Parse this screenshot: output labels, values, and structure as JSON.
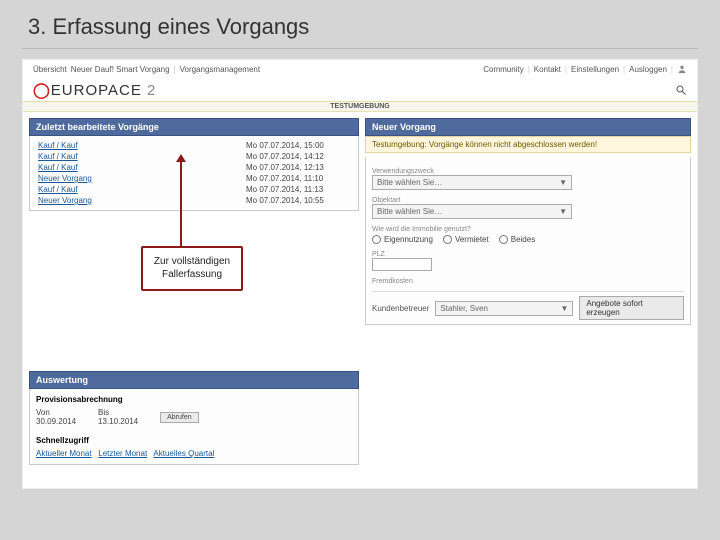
{
  "slide": {
    "title": "3. Erfassung eines Vorgangs"
  },
  "topnav": {
    "left": [
      "Übersicht",
      "Neuer Dauf! Smart Vorgang",
      "Vorgangsmanagement"
    ],
    "right": [
      "Community",
      "Kontakt",
      "Einstellungen",
      "Ausloggen"
    ]
  },
  "logo": {
    "brand": "EUROPACE",
    "suffix": "2"
  },
  "envband": "TESTUMGEBUNG",
  "leftpanel": {
    "header": "Zuletzt bearbeitete Vorgänge",
    "rows": [
      {
        "name": "Kauf / Kauf",
        "date": "Mo 07.07.2014, 15:00"
      },
      {
        "name": "Kauf / Kauf",
        "date": "Mo 07.07.2014, 14:12"
      },
      {
        "name": "Kauf / Kauf",
        "date": "Mo 07.07.2014, 12:13"
      },
      {
        "name": "Neuer Vorgang",
        "date": "Mo 07.07.2014, 11:10"
      },
      {
        "name": "Kauf / Kauf",
        "date": "Mo 07.07.2014, 11:13"
      },
      {
        "name": "Neuer Vorgang",
        "date": "Mo 07.07.2014, 10:55"
      }
    ]
  },
  "annotation": {
    "text": "Zur vollständigen Fallerfassung"
  },
  "rightpanel": {
    "header": "Neuer Vorgang",
    "warn": "Testumgebung: Vorgänge können nicht abgeschlossen werden!",
    "vz_label": "Verwendungszweck",
    "vz_placeholder": "Bitte wählen Sie…",
    "obj_label": "Objektart",
    "obj_placeholder": "Bitte wählen Sie…",
    "use_label": "Wie wird die Immobilie genutzt?",
    "radios": [
      "Eigennutzung",
      "Vermietet",
      "Beides"
    ],
    "plz_label": "PLZ",
    "fk_label": "Fremdkosten",
    "kb_label": "Kundenbetreuer",
    "kb_value": "Stahler, Sven",
    "submit": "Angebote sofort erzeugen"
  },
  "auswertung": {
    "header": "Auswertung",
    "section": "Provisionsabrechnung",
    "von_label": "Von",
    "von_value": "30.09.2014",
    "bis_label": "Bis",
    "bis_value": "13.10.2014",
    "btn": "Abrufen",
    "shortcut_label": "Schnellzugriff",
    "shortcuts": [
      "Aktueller Monat",
      "Letzter Monat",
      "Aktuelles Quartal"
    ]
  }
}
